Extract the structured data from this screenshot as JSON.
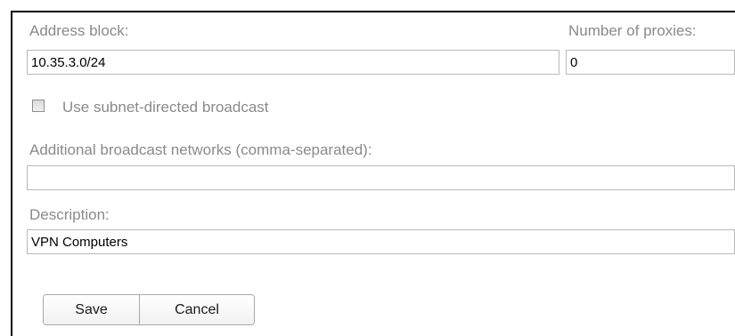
{
  "form": {
    "address_block": {
      "label": "Address block:",
      "value": "10.35.3.0/24"
    },
    "number_of_proxies": {
      "label": "Number of proxies:",
      "value": "0"
    },
    "subnet_broadcast": {
      "label": "Use subnet-directed broadcast",
      "checked": false
    },
    "additional_broadcast": {
      "label": "Additional broadcast networks (comma-separated):",
      "value": ""
    },
    "description": {
      "label": "Description:",
      "value": "VPN Computers"
    }
  },
  "buttons": {
    "save_label": "Save",
    "cancel_label": "Cancel"
  }
}
